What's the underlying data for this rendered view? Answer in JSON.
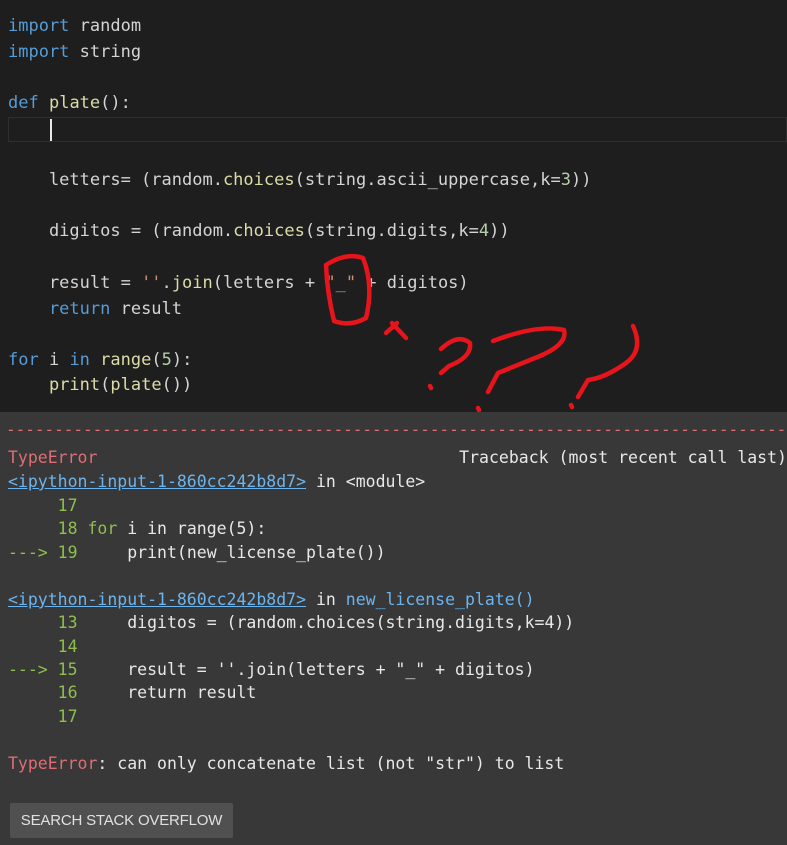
{
  "editor": {
    "lines": {
      "l1": {
        "kw": "import",
        "rest": " random"
      },
      "l2": {
        "kw": "import",
        "rest": " string"
      },
      "l4": {
        "kw": "def",
        "name": "plate",
        "rest": "():"
      },
      "l7": {
        "p1": "    letters= (random.",
        "fn": "choices",
        "p2": "(string.ascii_uppercase,k=",
        "num": "3",
        "p3": "))"
      },
      "l9": {
        "p1": "    digitos = (random.",
        "fn": "choices",
        "p2": "(string.digits,k=",
        "num": "4",
        "p3": "))"
      },
      "l11": {
        "p1": "    result = ",
        "str1": "''",
        "p2": ".",
        "fn": "join",
        "p3": "(letters + ",
        "str2": "\"_\"",
        "p4": " + digitos)"
      },
      "l12": {
        "kw": "    return",
        "rest": " result"
      },
      "l14": {
        "kw1": "for",
        "p1": " i ",
        "kw2": "in",
        "p2": " ",
        "fn": "range",
        "p3": "(",
        "num": "5",
        "p4": "):"
      },
      "l15": {
        "p1": "    ",
        "fn1": "print",
        "p2": "(",
        "fn2": "plate",
        "p3": "())"
      }
    }
  },
  "output": {
    "dashes": "--------------------------------------------------------------------------------------------------",
    "error_type": "TypeError",
    "traceback_label": "Traceback (most recent call last)",
    "frame1": {
      "link": "<ipython-input-1-860cc242b8d7>",
      "in_text": " in ",
      "scope": "<module>",
      "rows": [
        {
          "marker": "     ",
          "num": "17",
          "code_kw": "",
          "code": ""
        },
        {
          "marker": "     ",
          "num": "18",
          "code_kw": "for",
          "code": " i in range(5):"
        },
        {
          "marker": "---> ",
          "num": "19",
          "code_kw": "",
          "code": "print(new_license_plate())"
        }
      ]
    },
    "frame2": {
      "link": "<ipython-input-1-860cc242b8d7>",
      "in_text": " in ",
      "scope": "new_license_plate()",
      "rows": [
        {
          "marker": "     ",
          "num": "13",
          "code": "digitos = (random.choices(string.digits,k=4))"
        },
        {
          "marker": "     ",
          "num": "14",
          "code": ""
        },
        {
          "marker": "---> ",
          "num": "15",
          "code": "result = ''.join(letters + \"_\" + digitos)"
        },
        {
          "marker": "     ",
          "num": "16",
          "code": "return result"
        },
        {
          "marker": "     ",
          "num": "17",
          "code": ""
        }
      ]
    },
    "message_type": "TypeError",
    "message": ": can only concatenate list (not \"str\") to list",
    "search_button": "SEARCH STACK OVERFLOW"
  },
  "colors": {
    "editor_bg": "#1e1e1e",
    "output_bg": "#383838",
    "keyword": "#569cd6",
    "function": "#dcdcaa",
    "error": "#e06c75",
    "annotation": "#e8141c"
  }
}
